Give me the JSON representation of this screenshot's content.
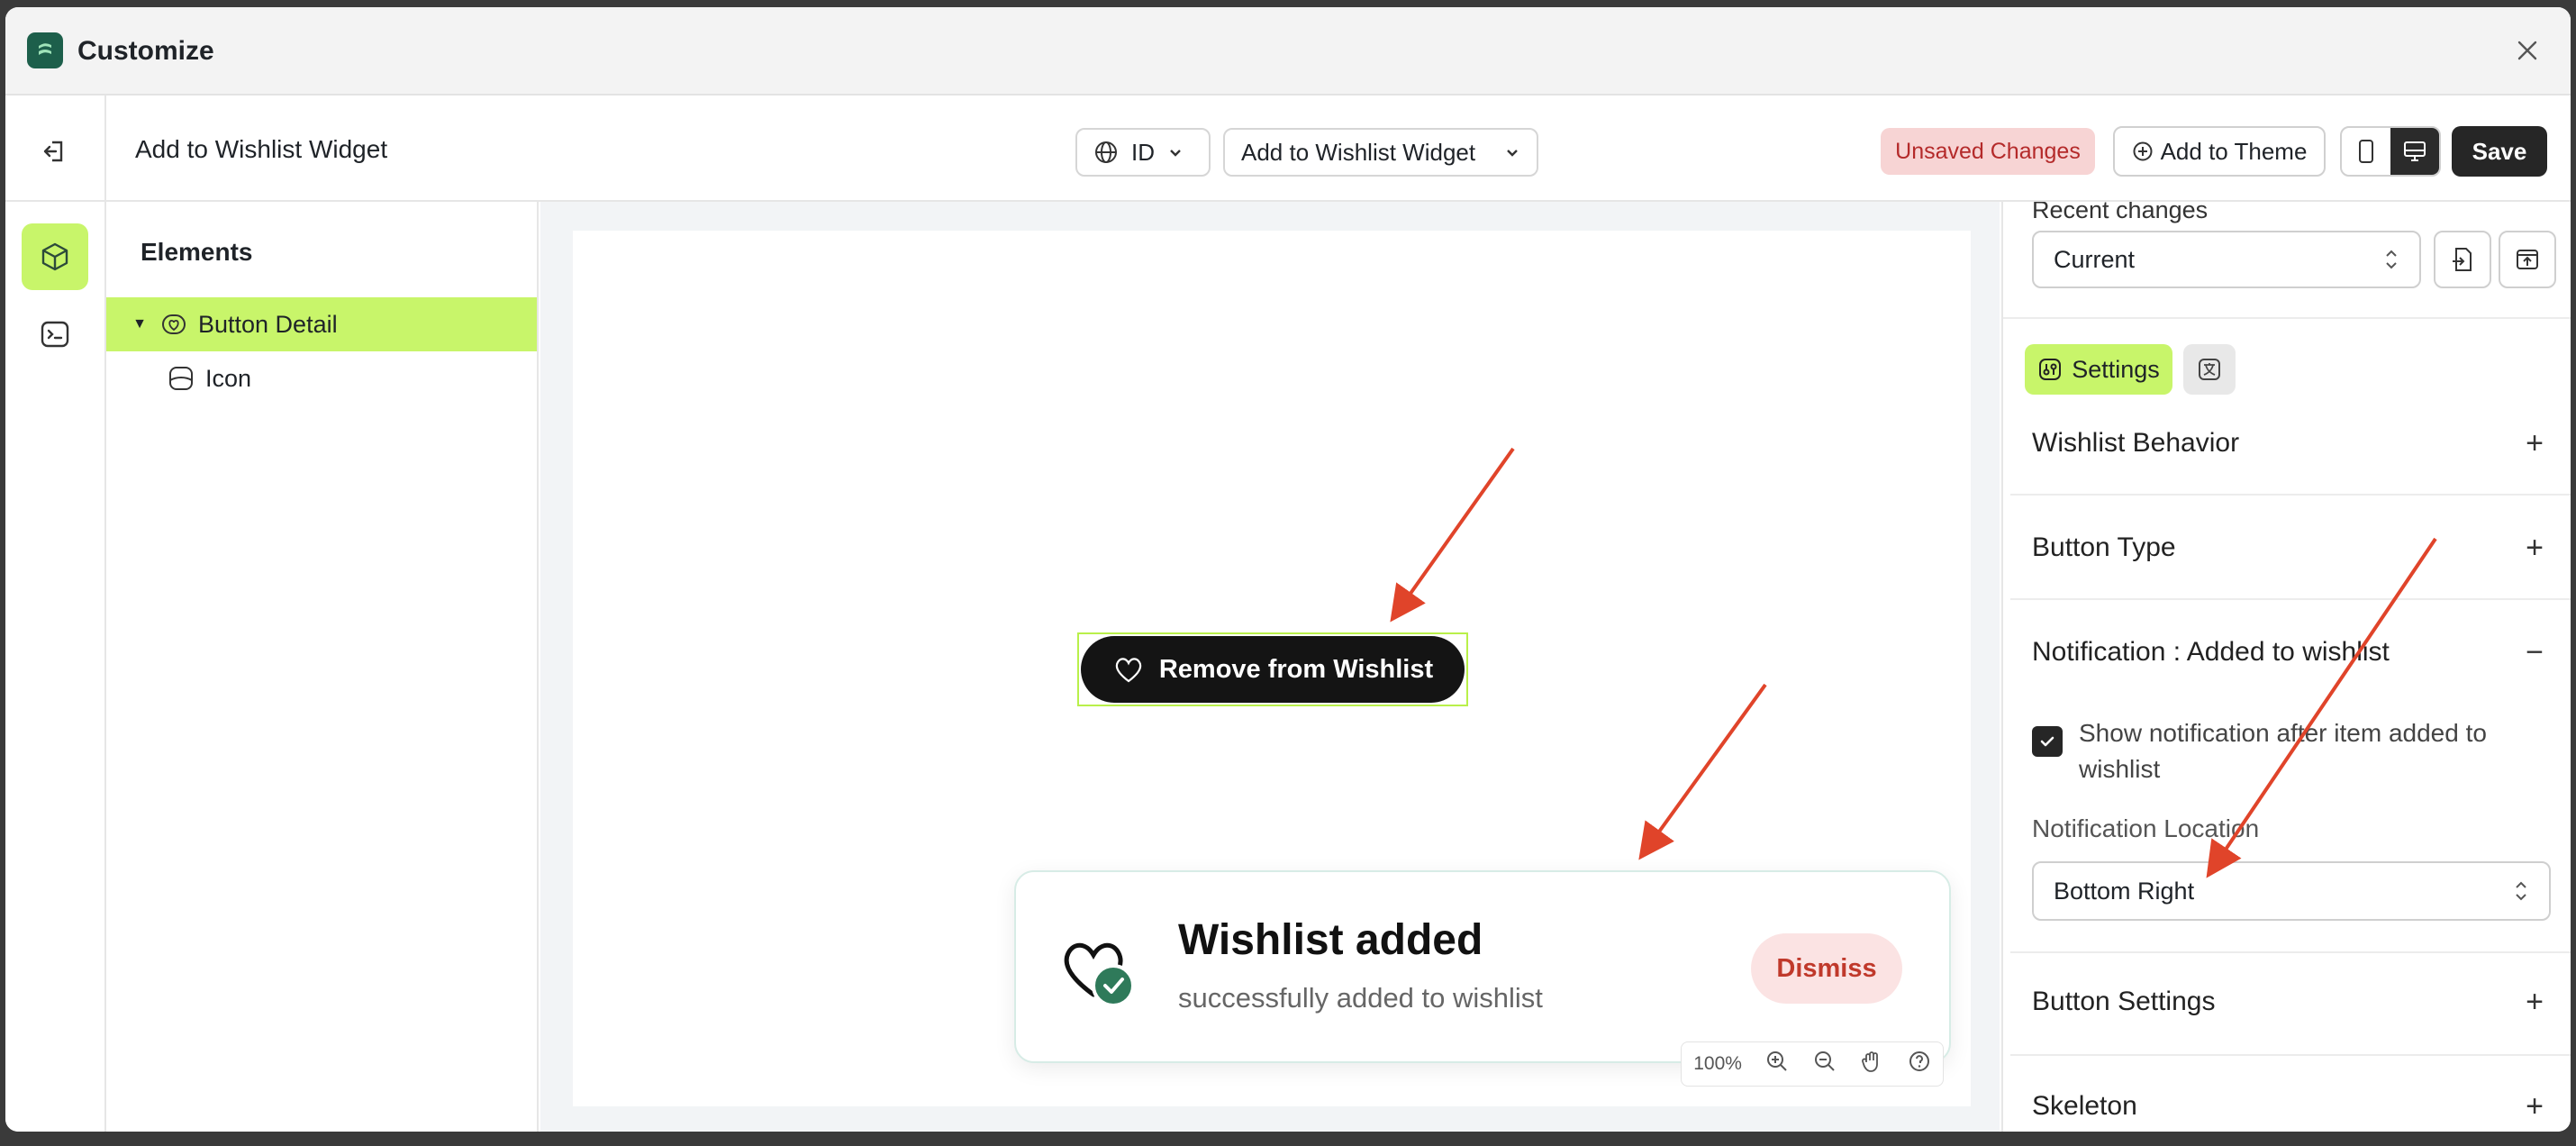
{
  "window": {
    "title": "Customize"
  },
  "toolbar": {
    "page_name": "Add to Wishlist Widget",
    "language": "ID",
    "template": "Add to Wishlist Widget",
    "unsaved": "Unsaved Changes",
    "add_to_theme": "Add to Theme",
    "save": "Save"
  },
  "elements": {
    "title": "Elements",
    "items": [
      {
        "label": "Button Detail"
      },
      {
        "label": "Icon"
      }
    ]
  },
  "canvas": {
    "button_label": "Remove from Wishlist",
    "toast_title": "Wishlist added",
    "toast_subtitle": "successfully added to wishlist",
    "dismiss": "Dismiss",
    "zoom": "100%"
  },
  "panel": {
    "recent_label": "Recent changes",
    "recent_value": "Current",
    "tab_settings": "Settings",
    "sections": [
      {
        "label": "Wishlist Behavior",
        "expanded": false
      },
      {
        "label": "Button Type",
        "expanded": false
      },
      {
        "label": "Notification : Added to wishlist",
        "expanded": true
      },
      {
        "label": "Button Settings",
        "expanded": false
      },
      {
        "label": "Skeleton",
        "expanded": false
      }
    ],
    "show_notification": "Show notification after item added to wishlist",
    "location_label": "Notification Location",
    "location_value": "Bottom Right"
  },
  "colors": {
    "accent": "#c8f56a",
    "annotation_arrow": "#e0442a"
  }
}
